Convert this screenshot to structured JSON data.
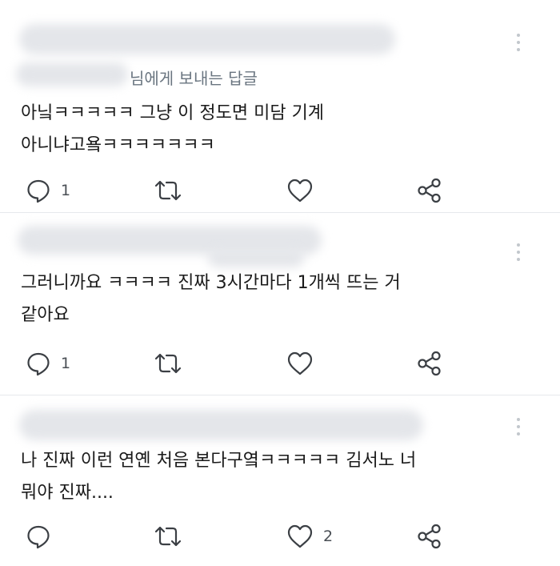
{
  "tweets": [
    {
      "reply_to": "님에게 보내는 답글",
      "text": "아닠ㅋㅋㅋㅋㅋ 그냥 이 정도면 미담 기계\n아니냐고욬ㅋㅋㅋㅋㅋㅋㅋ",
      "reply_count": "1",
      "like_count": ""
    },
    {
      "reply_to": "",
      "text": "그러니까요 ㅋㅋㅋㅋ 진짜 3시간마다 1개씩 뜨는 거\n같아요",
      "reply_count": "1",
      "like_count": ""
    },
    {
      "reply_to": "",
      "text": "나 진짜 이런 연옌 처음 본다구옄ㅋㅋㅋㅋㅋ 김서노 너\n뭐야 진짜....",
      "reply_count": "",
      "like_count": "2"
    }
  ],
  "icons": {
    "reply": "speech-bubble-icon",
    "retweet": "retweet-arrows-icon",
    "like": "heart-icon",
    "share": "share-nodes-icon",
    "more": "vertical-dots-icon"
  },
  "colors": {
    "icon": "#3b3f44",
    "redaction": "#e4e6ea",
    "secondary_text": "#6a7580"
  }
}
